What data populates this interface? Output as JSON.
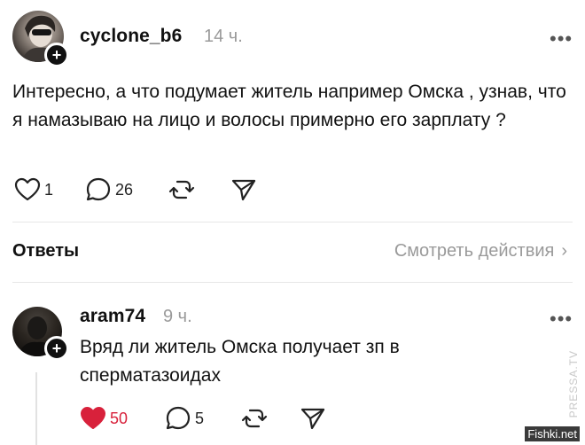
{
  "post": {
    "username": "cyclone_b6",
    "time": "14 ч.",
    "more": "•••",
    "text": "Интересно, а что подумает житель например Омска , узнав,  что я намазываю на лицо и волосы примерно его зарплату ?",
    "likes": "1",
    "comments": "26",
    "avatar_icon": "user-avatar",
    "follow_icon": "plus-icon"
  },
  "replies_section": {
    "title": "Ответы",
    "view_activity": "Смотреть действия",
    "chevron": "›"
  },
  "reply": {
    "username": "aram74",
    "time": "9 ч.",
    "more": "•••",
    "text": "Вряд ли житель Омска получает зп в сперматазоидах",
    "likes": "50",
    "comments": "5",
    "liked": true,
    "like_color": "#d8213b"
  },
  "watermarks": {
    "side": "PRESSA.TV",
    "corner": "Fishki.net"
  }
}
